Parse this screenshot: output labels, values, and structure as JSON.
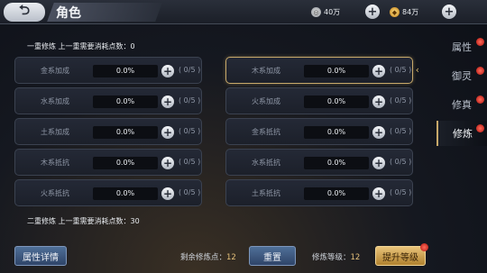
{
  "header": {
    "back_icon": "back-arrow-icon",
    "title": "角色",
    "silver": "40万",
    "gold": "84万"
  },
  "sections": [
    {
      "title": "一重修炼  上一重需要消耗点数：0",
      "cells": [
        {
          "label": "金系加成",
          "value": "0.0%",
          "count": "( 0/5 )"
        },
        {
          "label": "木系加成",
          "value": "0.0%",
          "count": "( 0/5 )",
          "selected": true
        },
        {
          "label": "水系加成",
          "value": "0.0%",
          "count": "( 0/5 )"
        },
        {
          "label": "火系加成",
          "value": "0.0%",
          "count": "( 0/5 )"
        },
        {
          "label": "土系加成",
          "value": "0.0%",
          "count": "( 0/5 )"
        },
        {
          "label": "金系抵抗",
          "value": "0.0%",
          "count": "( 0/5 )"
        },
        {
          "label": "木系抵抗",
          "value": "0.0%",
          "count": "( 0/5 )"
        },
        {
          "label": "水系抵抗",
          "value": "0.0%",
          "count": "( 0/5 )"
        },
        {
          "label": "火系抵抗",
          "value": "0.0%",
          "count": "( 0/5 )"
        },
        {
          "label": "土系抵抗",
          "value": "0.0%",
          "count": "( 0/5 )"
        }
      ]
    },
    {
      "title": "二重修炼  上一重需要消耗点数：30"
    }
  ],
  "tabs": [
    {
      "label": "属性"
    },
    {
      "label": "御灵"
    },
    {
      "label": "修真"
    },
    {
      "label": "修炼",
      "active": true
    }
  ],
  "footer": {
    "details_label": "属性详情",
    "remaining_label": "剩余修炼点：",
    "remaining_value": "12",
    "reset_label": "重置",
    "level_label": "修炼等级：",
    "level_value": "12",
    "upgrade_label": "提升等级"
  },
  "colors": {
    "accent_gold": "#c8a96a",
    "badge_red": "#d0201a",
    "button_blue": "#3d5680"
  }
}
